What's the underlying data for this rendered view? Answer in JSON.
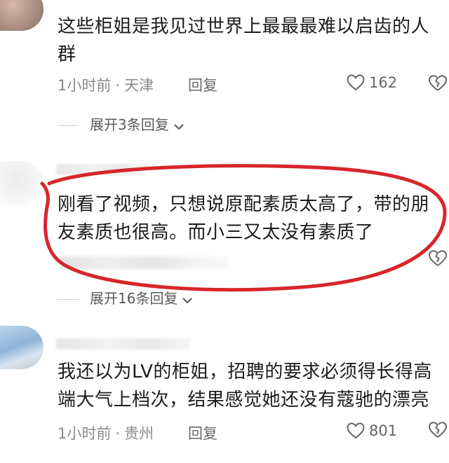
{
  "comments": [
    {
      "text": "这些柜姐是我见过世界上最最最难以启齿的人群",
      "time": "1小时前",
      "separator": "·",
      "location": "天津",
      "reply_label": "回复",
      "likes": "162",
      "expand_label": "展开3条回复"
    },
    {
      "text": "刚看了视频，只想说原配素质太高了，带的朋友素质也很高。而小三又太没有素质了",
      "expand_label": "展开16条回复"
    },
    {
      "text": "我还以为LV的柜姐，招聘的要求必须得长得高端大气上档次，结果感觉她还没有蔻驰的漂亮",
      "time": "1小时前",
      "separator": "·",
      "location": "贵州",
      "reply_label": "回复",
      "likes": "801"
    }
  ],
  "colors": {
    "highlight": "#d7262b",
    "meta": "#8a8a8a",
    "text": "#1c1c1c"
  },
  "icons": {
    "like": "heart-outline-icon",
    "dislike": "broken-heart-icon",
    "expand": "chevron-down-icon"
  }
}
